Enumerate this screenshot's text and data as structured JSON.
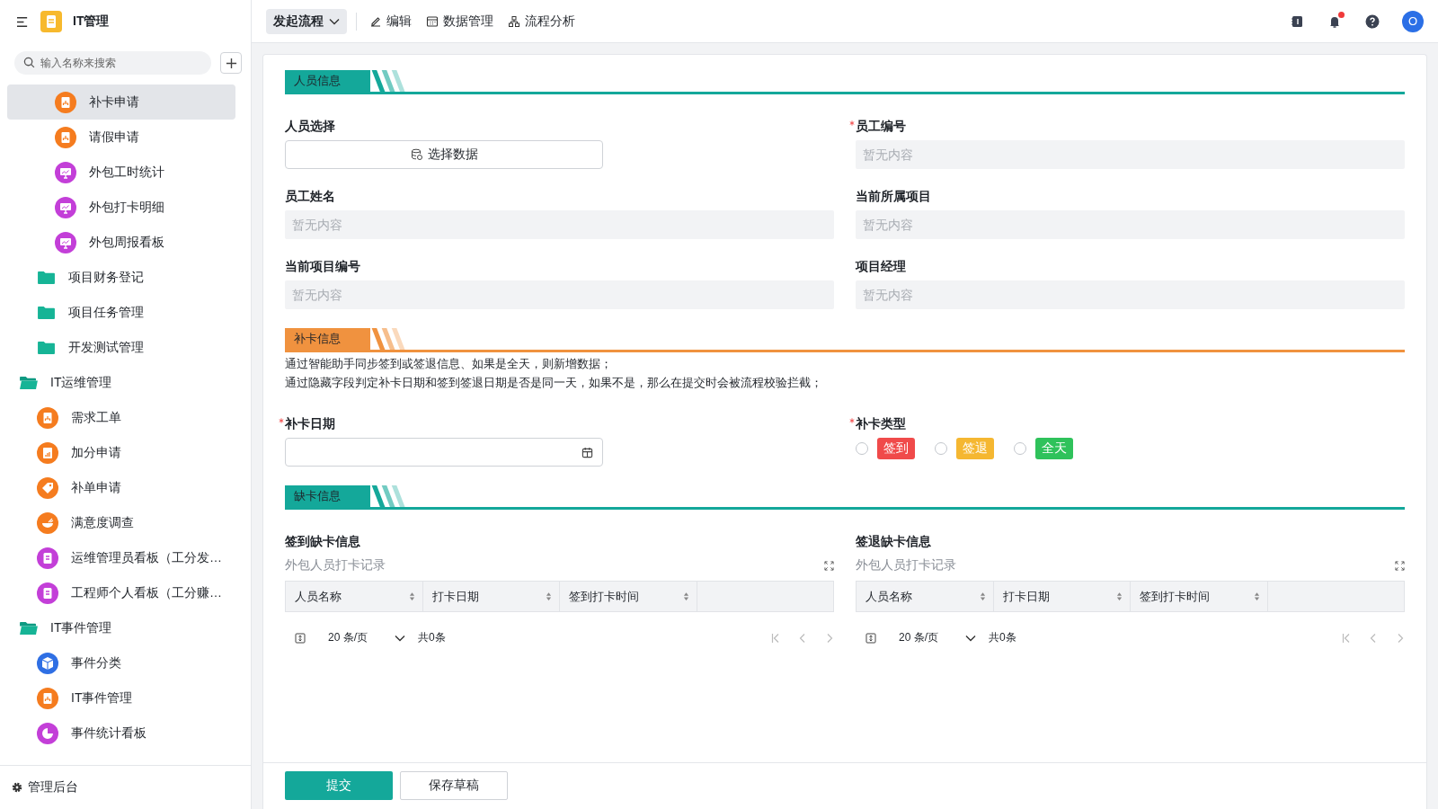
{
  "app": {
    "title": "IT管理"
  },
  "search": {
    "placeholder": "输入名称来搜索"
  },
  "sidebar": {
    "items": [
      {
        "children": [
          {
            "children": [
              {
                "label": "补卡申请",
                "kind": "clipboard",
                "color": "#f57c1f",
                "selected": true
              },
              {
                "label": "请假申请",
                "kind": "clipboard",
                "color": "#f57c1f",
                "selected": false
              },
              {
                "label": "外包工时统计",
                "kind": "monitor",
                "color": "#c33fd8",
                "selected": false
              },
              {
                "label": "外包打卡明细",
                "kind": "monitor",
                "color": "#c33fd8",
                "selected": false
              },
              {
                "label": "外包周报看板",
                "kind": "monitor",
                "color": "#c33fd8",
                "selected": false
              }
            ]
          },
          {
            "label": "项目财务登记",
            "kind": "folder",
            "expanded": false,
            "selected": false
          },
          {
            "label": "项目任务管理",
            "kind": "folder",
            "expanded": false,
            "selected": false
          },
          {
            "label": "开发测试管理",
            "kind": "folder",
            "expanded": false,
            "selected": false
          }
        ]
      },
      {
        "label": "IT运维管理",
        "kind": "folder",
        "expanded": true,
        "selected": false,
        "children": [
          {
            "label": "需求工单",
            "kind": "clipboard",
            "color": "#f57c1f",
            "selected": false
          },
          {
            "label": "加分申请",
            "kind": "chart",
            "color": "#f57c1f",
            "selected": false
          },
          {
            "label": "补单申请",
            "kind": "tag",
            "color": "#f57c1f",
            "selected": false
          },
          {
            "label": "满意度调查",
            "kind": "bowl",
            "color": "#f57c1f",
            "selected": false
          },
          {
            "label": "运维管理员看板（工分发…",
            "kind": "note",
            "color": "#c33fd8",
            "selected": false
          },
          {
            "label": "工程师个人看板（工分赚…",
            "kind": "note",
            "color": "#c33fd8",
            "selected": false
          }
        ]
      },
      {
        "label": "IT事件管理",
        "kind": "folder",
        "expanded": true,
        "selected": false,
        "children": [
          {
            "label": "事件分类",
            "kind": "box",
            "color": "#2f6fe4",
            "selected": false
          },
          {
            "label": "IT事件管理",
            "kind": "clipboard",
            "color": "#f57c1f",
            "selected": false
          },
          {
            "label": "事件统计看板",
            "kind": "pie",
            "color": "#c33fd8",
            "selected": false
          }
        ]
      }
    ],
    "footer": "管理后台"
  },
  "toolbar": {
    "launch": "发起流程",
    "actions": [
      {
        "label": "编辑",
        "kind": "edit"
      },
      {
        "label": "数据管理",
        "kind": "table"
      },
      {
        "label": "流程分析",
        "kind": "flow"
      }
    ],
    "notification": true,
    "avatar": "O"
  },
  "form": {
    "sections": [
      {
        "title": "人员信息",
        "color": "#14a89a",
        "fields": [
          {
            "kind": "picker",
            "label": "人员选择",
            "required": false,
            "button": "选择数据"
          },
          {
            "kind": "readonly",
            "label": "员工编号",
            "required": true,
            "placeholder": "暂无内容"
          },
          {
            "kind": "readonly",
            "label": "员工姓名",
            "required": false,
            "placeholder": "暂无内容"
          },
          {
            "kind": "readonly",
            "label": "当前所属项目",
            "required": false,
            "placeholder": "暂无内容"
          },
          {
            "kind": "readonly",
            "label": "当前项目编号",
            "required": false,
            "placeholder": "暂无内容"
          },
          {
            "kind": "readonly",
            "label": "项目经理",
            "required": false,
            "placeholder": "暂无内容"
          }
        ]
      },
      {
        "title": "补卡信息",
        "color": "#f0923f",
        "description": [
          "通过智能助手同步签到或签退信息、如果是全天，则新增数据；",
          "通过隐藏字段判定补卡日期和签到签退日期是否是同一天，如果不是，那么在提交时会被流程校验拦截；"
        ],
        "fields": [
          {
            "kind": "date",
            "label": "补卡日期",
            "required": true
          },
          {
            "kind": "radio",
            "label": "补卡类型",
            "required": true,
            "options": [
              {
                "label": "签到",
                "color": "#f04a4a",
                "selected": false
              },
              {
                "label": "签退",
                "color": "#f5b731",
                "selected": false
              },
              {
                "label": "全天",
                "color": "#2fc25b",
                "selected": false
              }
            ]
          }
        ]
      },
      {
        "title": "缺卡信息",
        "color": "#14a89a",
        "fields": [
          {
            "kind": "table",
            "label": "签到缺卡信息",
            "required": false,
            "caption": "外包人员打卡记录",
            "columns": [
              "人员名称",
              "打卡日期",
              "签到打卡时间"
            ],
            "page_size": "20 条/页",
            "total": "共0条"
          },
          {
            "kind": "table",
            "label": "签退缺卡信息",
            "required": false,
            "caption": "外包人员打卡记录",
            "columns": [
              "人员名称",
              "打卡日期",
              "签到打卡时间"
            ],
            "page_size": "20 条/页",
            "total": "共0条"
          }
        ]
      }
    ]
  },
  "actions": [
    {
      "label": "提交",
      "kind": "primary"
    },
    {
      "label": "保存草稿",
      "kind": "default"
    }
  ]
}
